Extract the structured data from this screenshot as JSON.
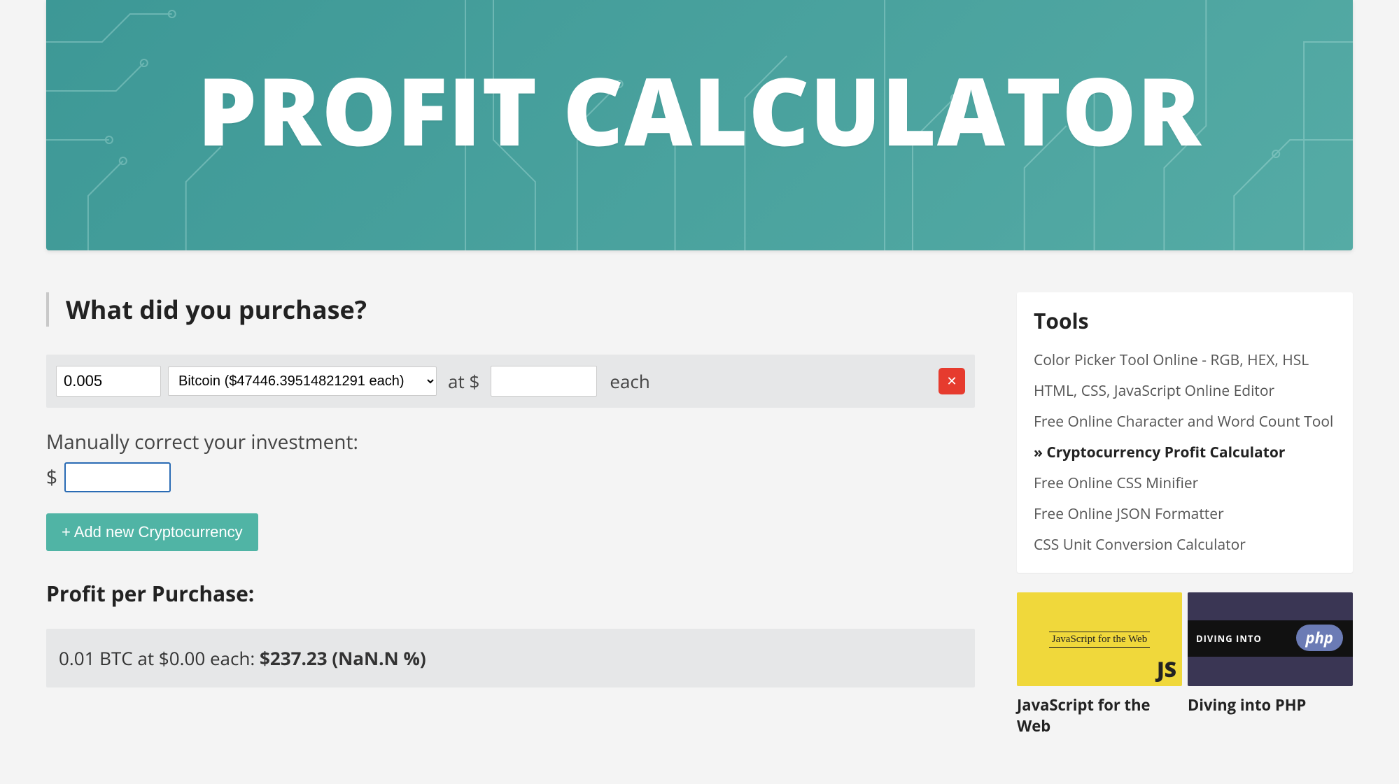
{
  "banner": {
    "title": "PROFIT CALCULATOR"
  },
  "main": {
    "question": "What did you purchase?",
    "purchase": {
      "qty": "0.005",
      "crypto": "Bitcoin ($47446.39514821291 each)",
      "at_label": "at $",
      "price": "",
      "each_label": "each"
    },
    "manual_label": "Manually correct your investment:",
    "dollar": "$",
    "manual_value": "",
    "add_button": "+ Add new Cryptocurrency",
    "profit_heading": "Profit per Purchase:",
    "profit_line_prefix": "0.01 BTC at $0.00 each:  ",
    "profit_line_bold": "$237.23 (NaN.N %)"
  },
  "sidebar": {
    "tools_title": "Tools",
    "tools": [
      {
        "label": "Color Picker Tool Online - RGB, HEX, HSL",
        "active": false
      },
      {
        "label": "HTML, CSS, JavaScript Online Editor",
        "active": false
      },
      {
        "label": "Free Online Character and Word Count Tool",
        "active": false
      },
      {
        "label": "»  Cryptocurrency Profit Calculator",
        "active": true
      },
      {
        "label": "Free Online CSS Minifier",
        "active": false
      },
      {
        "label": "Free Online JSON Formatter",
        "active": false
      },
      {
        "label": "CSS Unit Conversion Calculator",
        "active": false
      }
    ],
    "cards": {
      "js": {
        "thumb_small": "JavaScript for the Web",
        "thumb_badge": "JS",
        "title": "JavaScript for the Web"
      },
      "php": {
        "stripe_text": "DIVING INTO",
        "badge": "php",
        "title": "Diving into PHP"
      }
    }
  }
}
